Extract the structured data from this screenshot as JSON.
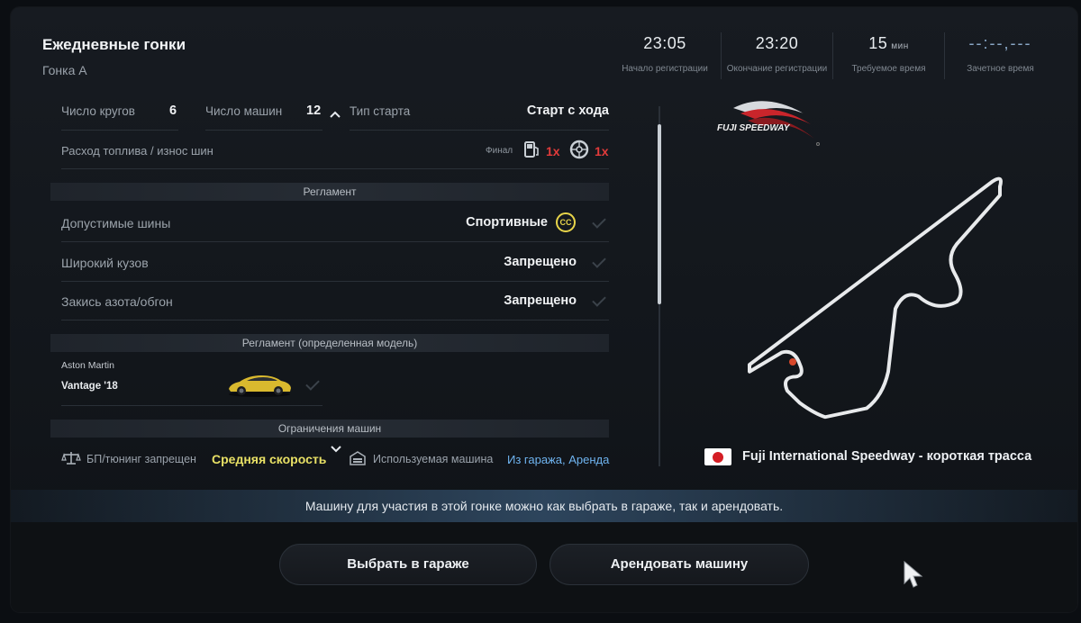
{
  "header": {
    "title": "Ежедневные гонки",
    "subtitle": "Гонка А"
  },
  "times": [
    {
      "value": "23:05",
      "unit": "",
      "label": "Начало регистрации"
    },
    {
      "value": "23:20",
      "unit": "",
      "label": "Окончание регистрации"
    },
    {
      "value": "15",
      "unit": "мин",
      "label": "Требуемое время"
    },
    {
      "value": "--:--,---",
      "unit": "",
      "label": "Зачетное время"
    }
  ],
  "race": {
    "laps_label": "Число кругов",
    "laps_value": "6",
    "cars_label": "Число машин",
    "cars_value": "12",
    "start_label": "Тип старта",
    "start_value": "Старт с хода",
    "wear_label": "Расход топлива / износ шин",
    "final_label": "Финал",
    "fuel_multiplier": "1x",
    "tire_multiplier": "1x"
  },
  "regulations": {
    "section_title": "Регламент",
    "tires_label": "Допустимые шины",
    "tires_value": "Спортивные",
    "tires_badge": "CC",
    "widebody_label": "Широкий кузов",
    "widebody_value": "Запрещено",
    "nitrous_label": "Закись азота/обгон",
    "nitrous_value": "Запрещено"
  },
  "model_regulations": {
    "section_title": "Регламент (определенная модель)",
    "make": "Aston Martin",
    "model": "Vantage '18"
  },
  "car_limits": {
    "section_title": "Ограничения машин",
    "bop_label": "БП/тюнинг запрещен",
    "bop_value": "Средняя скорость",
    "used_car_label": "Используемая машина",
    "used_car_value": "Из гаража, Аренда"
  },
  "track": {
    "logo_text": "FUJI SPEEDWAY",
    "name": "Fuji International Speedway - короткая трасса"
  },
  "info_message": "Машину для участия в этой гонке можно как выбрать в гараже, так и арендовать.",
  "buttons": {
    "garage": "Выбрать в гараже",
    "rent": "Арендовать машину"
  },
  "colors": {
    "accent_yellow": "#e8d44a",
    "accent_red": "#e23b3b",
    "accent_blue": "#6fb4f0"
  }
}
